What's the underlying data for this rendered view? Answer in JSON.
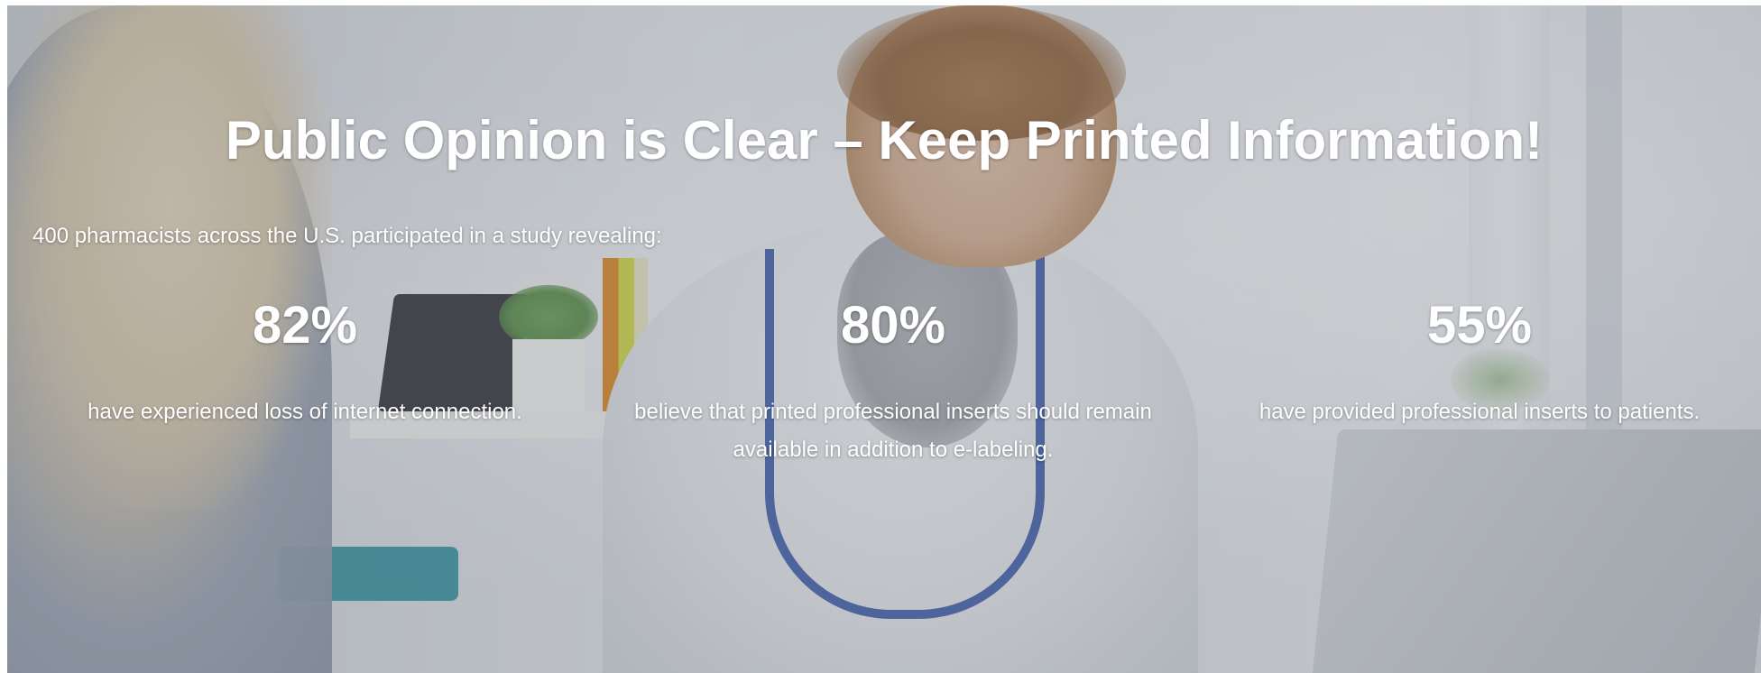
{
  "hero": {
    "title": "Public Opinion is Clear – Keep Printed Information!",
    "intro": "400 pharmacists across the U.S. participated in a study revealing:",
    "stats": [
      {
        "value": "82%",
        "description": "have experienced loss of internet connection."
      },
      {
        "value": "80%",
        "description": "believe that printed professional inserts should remain available in addition to e-labeling."
      },
      {
        "value": "55%",
        "description": "have provided professional inserts to patients."
      }
    ]
  }
}
